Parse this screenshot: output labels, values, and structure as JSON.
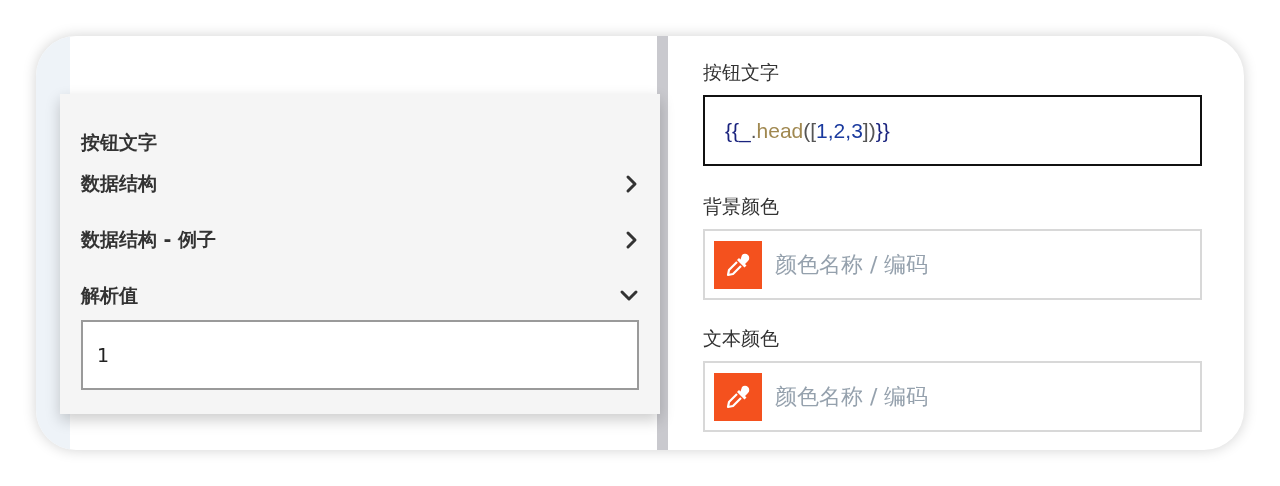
{
  "popover": {
    "title": "按钮文字",
    "sections": [
      {
        "label": "数据结构",
        "expanded": false
      },
      {
        "label": "数据结构 - 例子",
        "expanded": false
      },
      {
        "label": "解析值",
        "expanded": true,
        "value": "1"
      }
    ]
  },
  "form": {
    "fields": [
      {
        "label": "按钮文字",
        "kind": "code",
        "tokens": [
          {
            "text": "{{_",
            "kind": "brace"
          },
          {
            "text": ".",
            "kind": "punct"
          },
          {
            "text": "head",
            "kind": "method"
          },
          {
            "text": "([",
            "kind": "punct"
          },
          {
            "text": "1,2,3",
            "kind": "number"
          },
          {
            "text": "])",
            "kind": "punct"
          },
          {
            "text": "}}",
            "kind": "brace"
          }
        ]
      },
      {
        "label": "背景颜色",
        "kind": "color",
        "placeholder": "颜色名称 / 编码"
      },
      {
        "label": "文本颜色",
        "kind": "color",
        "placeholder": "颜色名称 / 编码"
      }
    ]
  }
}
